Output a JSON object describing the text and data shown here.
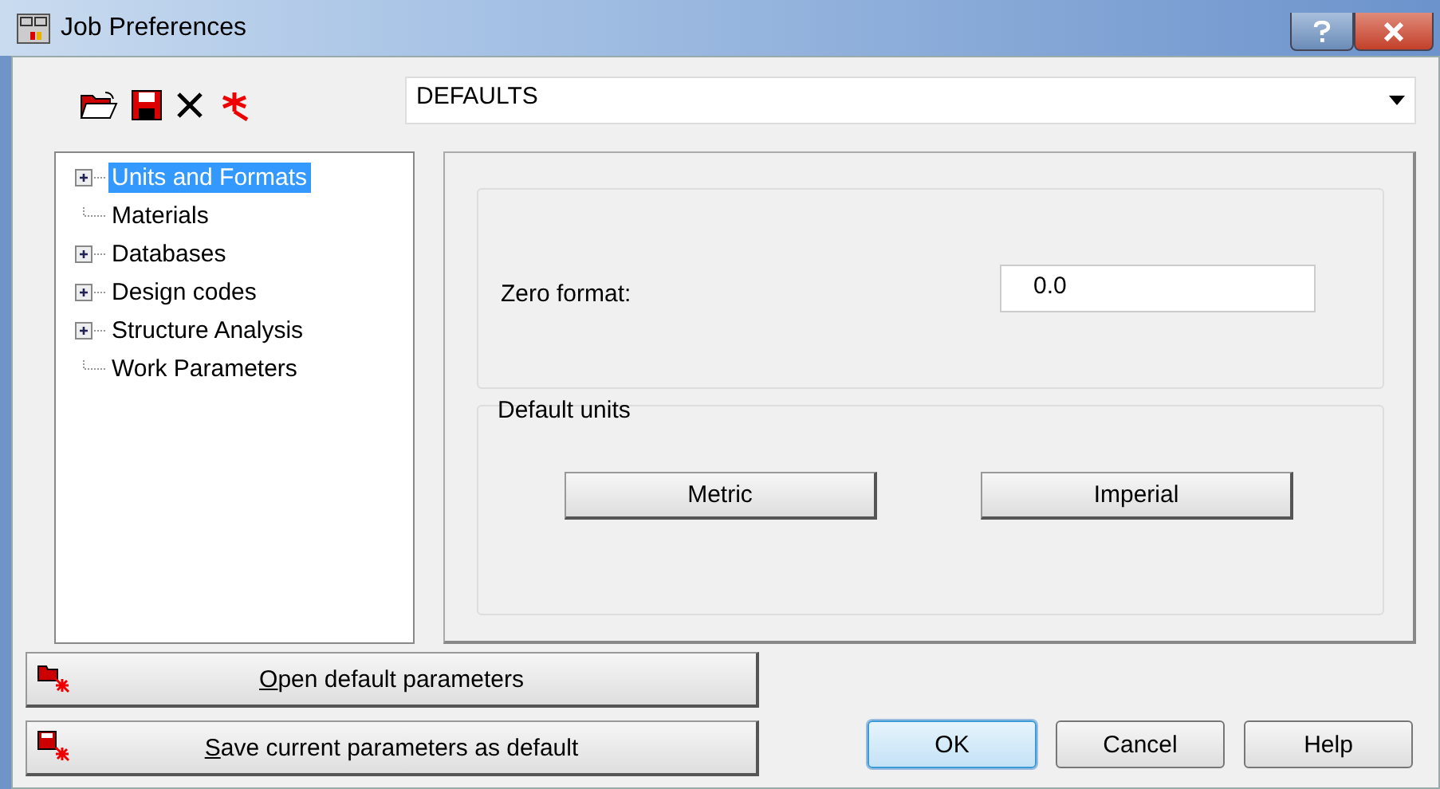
{
  "window": {
    "title": "Job Preferences"
  },
  "toolbar": {
    "preset": "DEFAULTS"
  },
  "tree": [
    {
      "label": "Units and Formats",
      "expandable": true,
      "selected": true
    },
    {
      "label": "Materials",
      "expandable": false,
      "selected": false
    },
    {
      "label": "Databases",
      "expandable": true,
      "selected": false
    },
    {
      "label": "Design codes",
      "expandable": true,
      "selected": false
    },
    {
      "label": "Structure Analysis",
      "expandable": true,
      "selected": false
    },
    {
      "label": "Work Parameters",
      "expandable": false,
      "selected": false
    }
  ],
  "zero_format": {
    "label": "Zero format:",
    "value": "0.0"
  },
  "default_units": {
    "title": "Default units",
    "buttons": [
      "Metric",
      "Imperial"
    ]
  },
  "parameter_buttons": [
    {
      "kind": "open",
      "mnemonic": "O",
      "rest": "pen default parameters"
    },
    {
      "kind": "save",
      "mnemonic": "S",
      "rest": "ave current parameters as default"
    }
  ],
  "dialog_buttons": [
    {
      "label": "OK",
      "selected": true
    },
    {
      "label": "Cancel",
      "selected": false
    },
    {
      "label": "Help",
      "selected": false
    }
  ]
}
